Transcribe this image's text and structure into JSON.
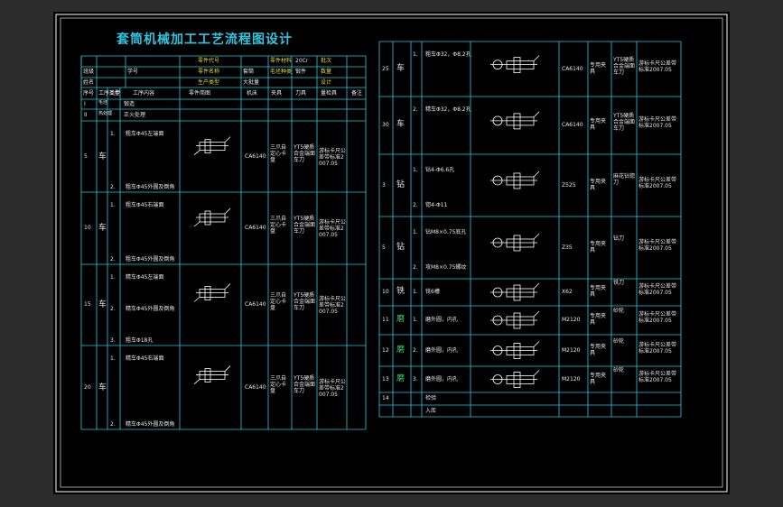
{
  "title": "套筒机械加工工艺流程图设计",
  "header_rows": [
    [
      "",
      "",
      "",
      "零件代号",
      "",
      "零件材料",
      "20Cr",
      "批次",
      ""
    ],
    [
      "班级",
      "",
      "学号",
      "零件名称",
      "套筒",
      "毛坯种类",
      "锻件",
      "数量",
      ""
    ],
    [
      "姓名",
      "",
      "",
      "生产类型",
      "大批量",
      "",
      "",
      "设计",
      ""
    ]
  ],
  "column_headers": {
    "seq": "序号",
    "type": "工序类型",
    "step": "工步",
    "content": "工序内容",
    "sketch": "零件简图",
    "machine": "机床",
    "fixture": "夹具",
    "tool": "刀具",
    "measure": "量检具",
    "remark": "备注"
  },
  "left_ops": [
    {
      "seq": "I",
      "type": "毛坯",
      "steps": [
        {
          "n": "",
          "text": "锻造"
        }
      ],
      "machine": "",
      "fixture": "",
      "tool": "",
      "measure": ""
    },
    {
      "seq": "II",
      "type": "热处理",
      "steps": [
        {
          "n": "",
          "text": "正火处理"
        }
      ],
      "machine": "",
      "fixture": "",
      "tool": "",
      "measure": ""
    },
    {
      "seq": "5",
      "type": "车",
      "steps": [
        {
          "n": "1.",
          "text": "粗车Φ45左端面"
        },
        {
          "n": "2.",
          "text": "粗车Φ45外圆及倒角"
        }
      ],
      "machine": "CA6140",
      "fixture": "三爪自定心卡盘",
      "tool": "YT5硬质合金端面车刀",
      "measure": "游标卡尺公差带标准2007.05"
    },
    {
      "seq": "10",
      "type": "车",
      "steps": [
        {
          "n": "1.",
          "text": "粗车Φ45右端面"
        },
        {
          "n": "2.",
          "text": "粗车Φ45外圆及倒角"
        }
      ],
      "machine": "CA6140",
      "fixture": "三爪自定心卡盘",
      "tool": "YT5硬质合金端面车刀",
      "measure": "游标卡尺公差带标准2007.05"
    },
    {
      "seq": "15",
      "type": "车",
      "steps": [
        {
          "n": "1.",
          "text": "精车Φ45左端面"
        },
        {
          "n": "2.",
          "text": "精车Φ45外圆及倒角"
        },
        {
          "n": "3.",
          "text": "粗车Φ18孔"
        }
      ],
      "machine": "CA6140",
      "fixture": "三爪自定心卡盘",
      "tool": "YT5硬质合金端面车刀",
      "measure": "游标卡尺公差带标准2007.05"
    },
    {
      "seq": "20",
      "type": "车",
      "steps": [
        {
          "n": "1.",
          "text": "精车Φ45右端面"
        },
        {
          "n": "2.",
          "text": "精车Φ45外圆及倒角"
        }
      ],
      "machine": "CA6140",
      "fixture": "三爪自定心卡盘",
      "tool": "YT5硬质合金端面车刀",
      "measure": "游标卡尺公差带标准2007.05"
    }
  ],
  "right_ops": [
    {
      "seq": "25",
      "type": "车",
      "steps": [
        {
          "n": "1.",
          "text": "粗车Φ32，Φ8.2孔"
        }
      ],
      "machine": "CA6140",
      "fixture": "专用夹具",
      "tool": "YT5硬质合金端面车刀",
      "measure": "游标卡尺公差带标准2007.05"
    },
    {
      "seq": "30",
      "type": "车",
      "steps": [
        {
          "n": "2.",
          "text": "精车Φ32，Φ8.2孔"
        }
      ],
      "machine": "CA6140",
      "fixture": "专用夹具",
      "tool": "YT5硬质合金端面车刀",
      "measure": "游标卡尺公差带标准2007.05"
    },
    {
      "seq": "3",
      "type": "钻",
      "steps": [
        {
          "n": "1.",
          "text": "钻4-Φ6.6孔"
        },
        {
          "n": "2.",
          "text": "锪4-Φ11"
        }
      ],
      "machine": "Z525",
      "fixture": "专用夹具",
      "tool": "麻花钻锪刀",
      "measure": "游标卡尺公差带标准2007.05"
    },
    {
      "seq": "5",
      "type": "钻",
      "steps": [
        {
          "n": "1.",
          "text": "钻M8×0.75底孔"
        },
        {
          "n": "2.",
          "text": "攻M8×0.75螺纹"
        }
      ],
      "machine": "Z35",
      "fixture": "专用夹具",
      "tool": "钻刀",
      "measure": "游标卡尺公差带标准2007.05"
    },
    {
      "seq": "10",
      "type": "铣",
      "steps": [
        {
          "n": "1.",
          "text": "铣6槽"
        }
      ],
      "machine": "X62",
      "fixture": "专用夹具",
      "tool": "铣刀",
      "measure": "游标卡尺公差带标准2007.05"
    },
    {
      "seq": "11",
      "type": "磨",
      "steps": [
        {
          "n": "1.",
          "text": "磨外圆，内孔"
        }
      ],
      "machine": "M2120",
      "fixture": "专用夹具",
      "tool": "砂轮",
      "measure": "游标卡尺公差带标准2007.05"
    },
    {
      "seq": "12",
      "type": "磨",
      "steps": [
        {
          "n": "2.",
          "text": "磨外圆，内孔"
        }
      ],
      "machine": "M2120",
      "fixture": "专用夹具",
      "tool": "砂轮",
      "measure": "游标卡尺公差带标准2007.05"
    },
    {
      "seq": "13",
      "type": "磨",
      "steps": [
        {
          "n": "3.",
          "text": "磨外圆，内孔"
        }
      ],
      "machine": "M2120",
      "fixture": "专用夹具",
      "tool": "砂轮",
      "measure": "游标卡尺公差带标准2007.05"
    },
    {
      "seq": "14",
      "type": "",
      "steps": [
        {
          "n": "",
          "text": "检验"
        }
      ],
      "machine": "",
      "fixture": "",
      "tool": "",
      "measure": ""
    },
    {
      "seq": "",
      "type": "",
      "steps": [
        {
          "n": "",
          "text": "入库"
        }
      ],
      "machine": "",
      "fixture": "",
      "tool": "",
      "measure": ""
    }
  ],
  "colors": {
    "line": "#31c6e0",
    "text": "#e8e8e8",
    "accent": "#e6d84a",
    "green": "#3ad06a",
    "bg": "#000000"
  }
}
